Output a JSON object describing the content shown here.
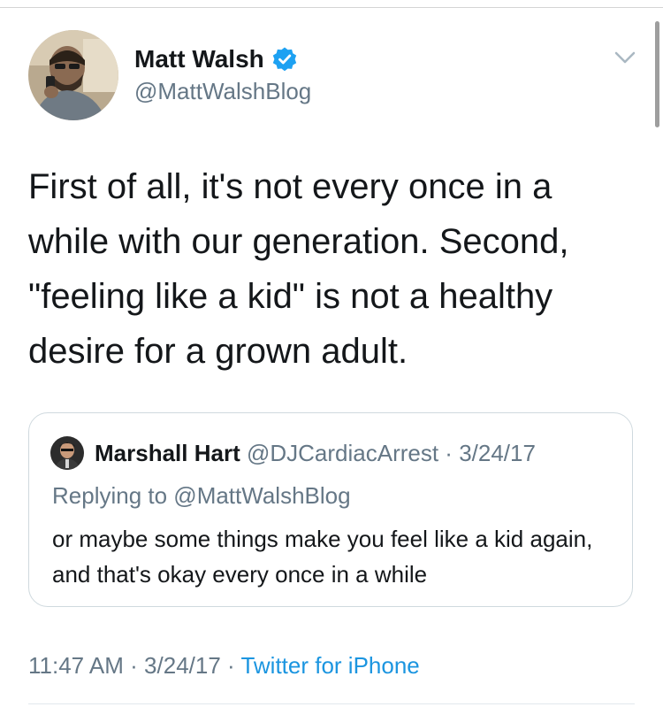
{
  "tweet": {
    "author": {
      "name": "Matt Walsh",
      "handle": "@MattWalshBlog",
      "verified": true,
      "verified_color": "#1da1f2",
      "avatar_icon": "profile-photo"
    },
    "text": "First of all, it's not every once in a while with our generation. Second, \"feeling like a kid\" is not a healthy desire for a grown adult.",
    "menu_icon": "chevron-down-icon",
    "quoted": {
      "name": "Marshall Hart",
      "handle": "@DJCardiacArrest",
      "separator": " · ",
      "date": "3/24/17",
      "replying_to": "Replying to @MattWalshBlog",
      "text": "or maybe some things make you feel like a kid again, and that's okay every once in a while",
      "avatar_icon": "profile-photo"
    },
    "meta": {
      "time": "11:47 AM",
      "separator1": " · ",
      "date": "3/24/17",
      "separator2": " · ",
      "source": "Twitter for iPhone",
      "source_color": "#1b95e0"
    }
  }
}
